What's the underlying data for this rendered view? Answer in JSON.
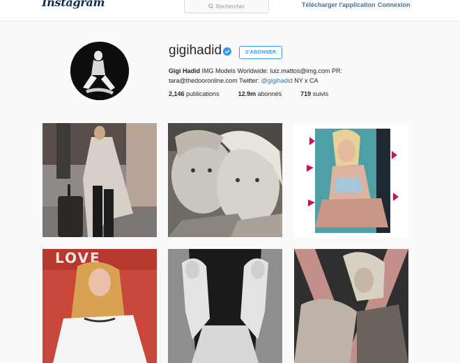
{
  "header": {
    "logo": "Instagram",
    "search_placeholder": "Rechercher",
    "download_link": "Télécharger l'application",
    "login_link": "Connexion"
  },
  "profile": {
    "username": "gigihadid",
    "follow_label": "S'ABONNER",
    "bio_name": "Gigi Hadid",
    "bio_line1": " IMG Models Worldwide: luiz.mattos@img.com PR:",
    "bio_line2": "tara@thedooronline.com Twitter: ",
    "bio_handle": "@gigihadid",
    "bio_tail": " NY x CA",
    "stats": [
      {
        "value": "2,146",
        "label": " publications"
      },
      {
        "value": "12.9m",
        "label": " abonnés"
      },
      {
        "value": "719",
        "label": " suivis"
      }
    ]
  },
  "posts": [
    {
      "alt": "post-street-style"
    },
    {
      "alt": "post-childhood-photo"
    },
    {
      "alt": "post-magazine-portrait"
    },
    {
      "alt": "post-love-sign"
    },
    {
      "alt": "post-mirrored-bw"
    },
    {
      "alt": "post-v-magazine"
    }
  ],
  "colors": {
    "link": "#3f729b",
    "accent": "#3897f0",
    "background": "#fafafa"
  }
}
